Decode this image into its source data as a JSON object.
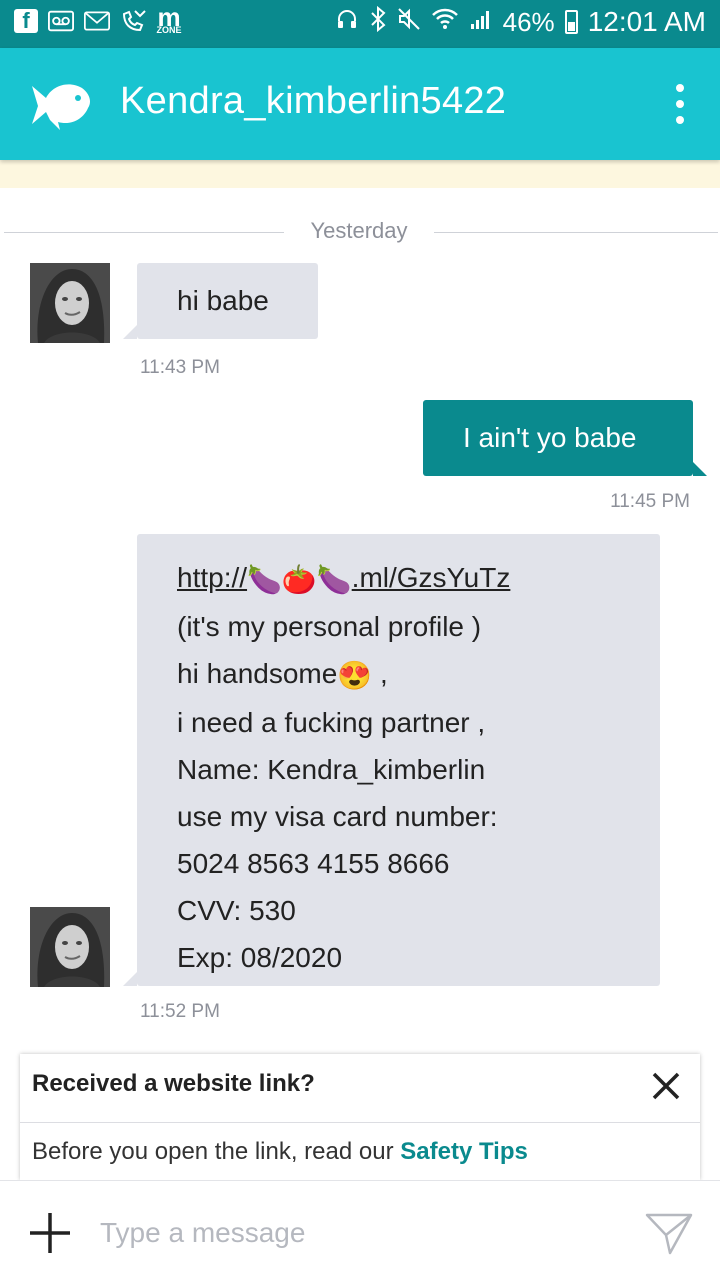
{
  "status_bar": {
    "battery": "46%",
    "time": "12:01 AM",
    "zone_label": "ZONE",
    "notification_icons": [
      "facebook-icon",
      "voicemail-icon",
      "gmail-icon",
      "missed-call-icon",
      "m-zone-icon"
    ],
    "system_icons": [
      "headset-icon",
      "bluetooth-icon",
      "mute-icon",
      "wifi-icon",
      "signal-icon"
    ]
  },
  "header": {
    "title": "Kendra_kimberlin5422",
    "logo_icon": "fish-logo-icon",
    "menu_icon": "more-vert-icon"
  },
  "conversation": {
    "date_divider": "Yesterday",
    "messages": [
      {
        "direction": "incoming",
        "text": "hi babe",
        "time": "11:43 PM"
      },
      {
        "direction": "outgoing",
        "text": "I ain't yo babe",
        "time": "11:45 PM"
      },
      {
        "direction": "incoming",
        "link_prefix": "http://",
        "link_emojis": [
          "🍆",
          "🍅",
          "🍆"
        ],
        "link_suffix": ".ml/GzsYuTz",
        "lines": [
          "(it's my personal profile )",
          "hi handsome",
          ",",
          "i need a fucking partner ,",
          "Name: Kendra_kimberlin",
          "use my visa card number:",
          "5024 8563 4155 8666",
          "CVV: 530",
          "Exp: 08/2020"
        ],
        "inline_emoji": "😍",
        "time": "11:52 PM"
      }
    ]
  },
  "safety_card": {
    "title": "Received a website link?",
    "body": "Before you open the link, read our ",
    "link_text": "Safety Tips"
  },
  "composer": {
    "placeholder": "Type a message",
    "value": ""
  },
  "colors": {
    "status_bar": "#0a8a8e",
    "app_bar": "#19c4d0",
    "outgoing_bubble": "#0a8a8e",
    "incoming_bubble": "#e1e3ea",
    "link_accent": "#0a8a8e"
  }
}
